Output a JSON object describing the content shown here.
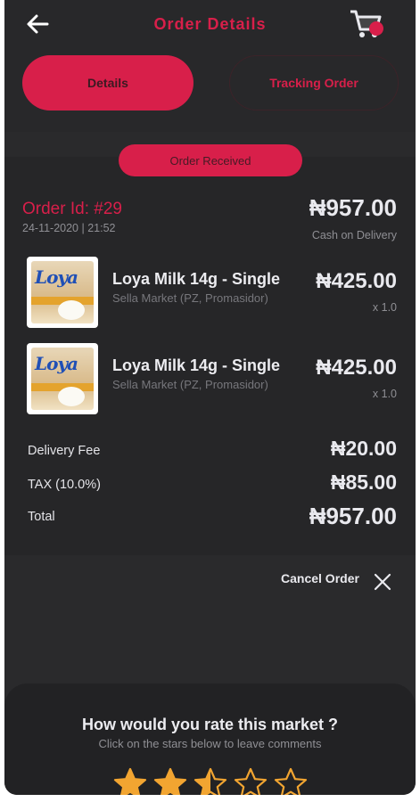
{
  "header": {
    "title": "Order Details",
    "back_icon": "arrow-left-icon",
    "cart_icon": "cart-icon"
  },
  "tabs": [
    {
      "label": "Details",
      "active": true
    },
    {
      "label": "Tracking Order",
      "active": false
    }
  ],
  "order": {
    "status": "Order Received",
    "id_label": "Order Id: #29",
    "date": "24-11-2020 | 21:52",
    "total": "₦957.00",
    "payment_method": "Cash on Delivery",
    "items": [
      {
        "name": "Loya Milk 14g - Single",
        "market": "Sella Market (PZ, Promasidor)",
        "price": "₦425.00",
        "qty": "x 1.0",
        "brand": "Loya"
      },
      {
        "name": "Loya Milk 14g - Single",
        "market": "Sella Market (PZ, Promasidor)",
        "price": "₦425.00",
        "qty": "x 1.0",
        "brand": "Loya"
      }
    ],
    "summary": {
      "delivery_label": "Delivery Fee",
      "delivery_value": "₦20.00",
      "tax_label": "TAX (10.0%)",
      "tax_value": "₦85.00",
      "total_label": "Total",
      "total_value": "₦957.00"
    }
  },
  "cancel": {
    "label": "Cancel Order",
    "icon": "close-icon"
  },
  "rating": {
    "title": "How would you rate this market ?",
    "subtitle": "Click on the stars below to leave comments",
    "value": 2.5,
    "max": 5
  },
  "colors": {
    "accent": "#d81f4a",
    "background": "#2a2a2c",
    "star": "#f2a531"
  }
}
